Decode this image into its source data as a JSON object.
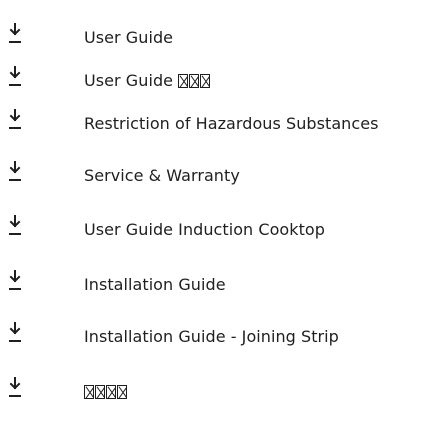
{
  "icons": {
    "download": "download-icon",
    "missing_glyph": "missing-glyph-box"
  },
  "colors": {
    "text": "#1f1f1f",
    "icon": "#1f1f1f",
    "background": "#ffffff"
  },
  "documents": [
    {
      "title": "User Guide"
    },
    {
      "title": "User Guide ",
      "unrendered_glyphs": 3
    },
    {
      "title": "Restriction of Hazardous Substances"
    },
    {
      "title": "Service & Warranty"
    },
    {
      "title": "User Guide Induction Cooktop"
    },
    {
      "title": "Installation Guide"
    },
    {
      "title": "Installation Guide - Joining Strip"
    },
    {
      "title": "",
      "unrendered_glyphs": 4
    }
  ]
}
